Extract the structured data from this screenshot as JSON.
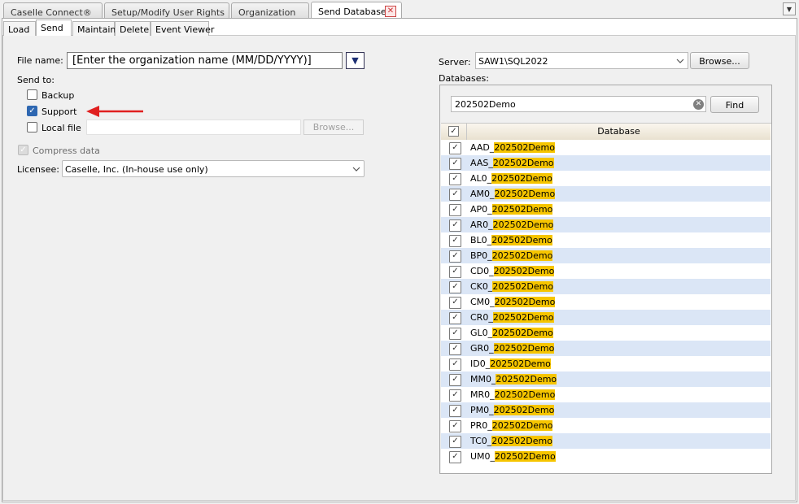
{
  "tabs": [
    {
      "label": "Caselle Connect®"
    },
    {
      "label": "Setup/Modify User Rights"
    },
    {
      "label": "Organization"
    },
    {
      "label": "Send Databases"
    }
  ],
  "subtabs": [
    {
      "label": "Load"
    },
    {
      "label": "Send"
    },
    {
      "label": "Maintain"
    },
    {
      "label": "Delete"
    },
    {
      "label": "Event Viewer"
    }
  ],
  "form": {
    "file_name_label": "File name:",
    "file_name_value": "[Enter the organization name (MM/DD/YYYY)]",
    "send_to_label": "Send to:",
    "backup_label": "Backup",
    "support_label": "Support",
    "local_file_label": "Local file",
    "browse_label": "Browse...",
    "compress_label": "Compress data",
    "licensee_label": "Licensee:",
    "licensee_value": "Caselle, Inc. (In-house use only)"
  },
  "server": {
    "server_label": "Server:",
    "server_value": "SAW1\\SQL2022",
    "browse_label": "Browse...",
    "databases_label": "Databases:",
    "search_value": "202502Demo",
    "find_label": "Find",
    "column_header": "Database",
    "rows": [
      {
        "prefix": "AAD_",
        "match": "202502Demo"
      },
      {
        "prefix": "AAS_",
        "match": "202502Demo"
      },
      {
        "prefix": "AL0_",
        "match": "202502Demo"
      },
      {
        "prefix": "AM0_",
        "match": "202502Demo"
      },
      {
        "prefix": "AP0_",
        "match": "202502Demo"
      },
      {
        "prefix": "AR0_",
        "match": "202502Demo"
      },
      {
        "prefix": "BL0_",
        "match": "202502Demo"
      },
      {
        "prefix": "BP0_",
        "match": "202502Demo"
      },
      {
        "prefix": "CD0_",
        "match": "202502Demo"
      },
      {
        "prefix": "CK0_",
        "match": "202502Demo"
      },
      {
        "prefix": "CM0_",
        "match": "202502Demo"
      },
      {
        "prefix": "CR0_",
        "match": "202502Demo"
      },
      {
        "prefix": "GL0_",
        "match": "202502Demo"
      },
      {
        "prefix": "GR0_",
        "match": "202502Demo"
      },
      {
        "prefix": "ID0_",
        "match": "202502Demo"
      },
      {
        "prefix": "MM0_",
        "match": "202502Demo"
      },
      {
        "prefix": "MR0_",
        "match": "202502Demo"
      },
      {
        "prefix": "PM0_",
        "match": "202502Demo"
      },
      {
        "prefix": "PR0_",
        "match": "202502Demo"
      },
      {
        "prefix": "TC0_",
        "match": "202502Demo"
      },
      {
        "prefix": "UM0_",
        "match": "202502Demo"
      }
    ]
  },
  "colors": {
    "highlight": "#f6c500",
    "alt_row": "#dbe6f6",
    "accent": "#2e67b1",
    "arrow": "#e02020"
  },
  "icons": {
    "close": "close-icon",
    "dropdown": "chevron-down-icon",
    "clear": "clear-icon",
    "check": "checkmark-icon",
    "arrow": "arrow-left-icon"
  }
}
